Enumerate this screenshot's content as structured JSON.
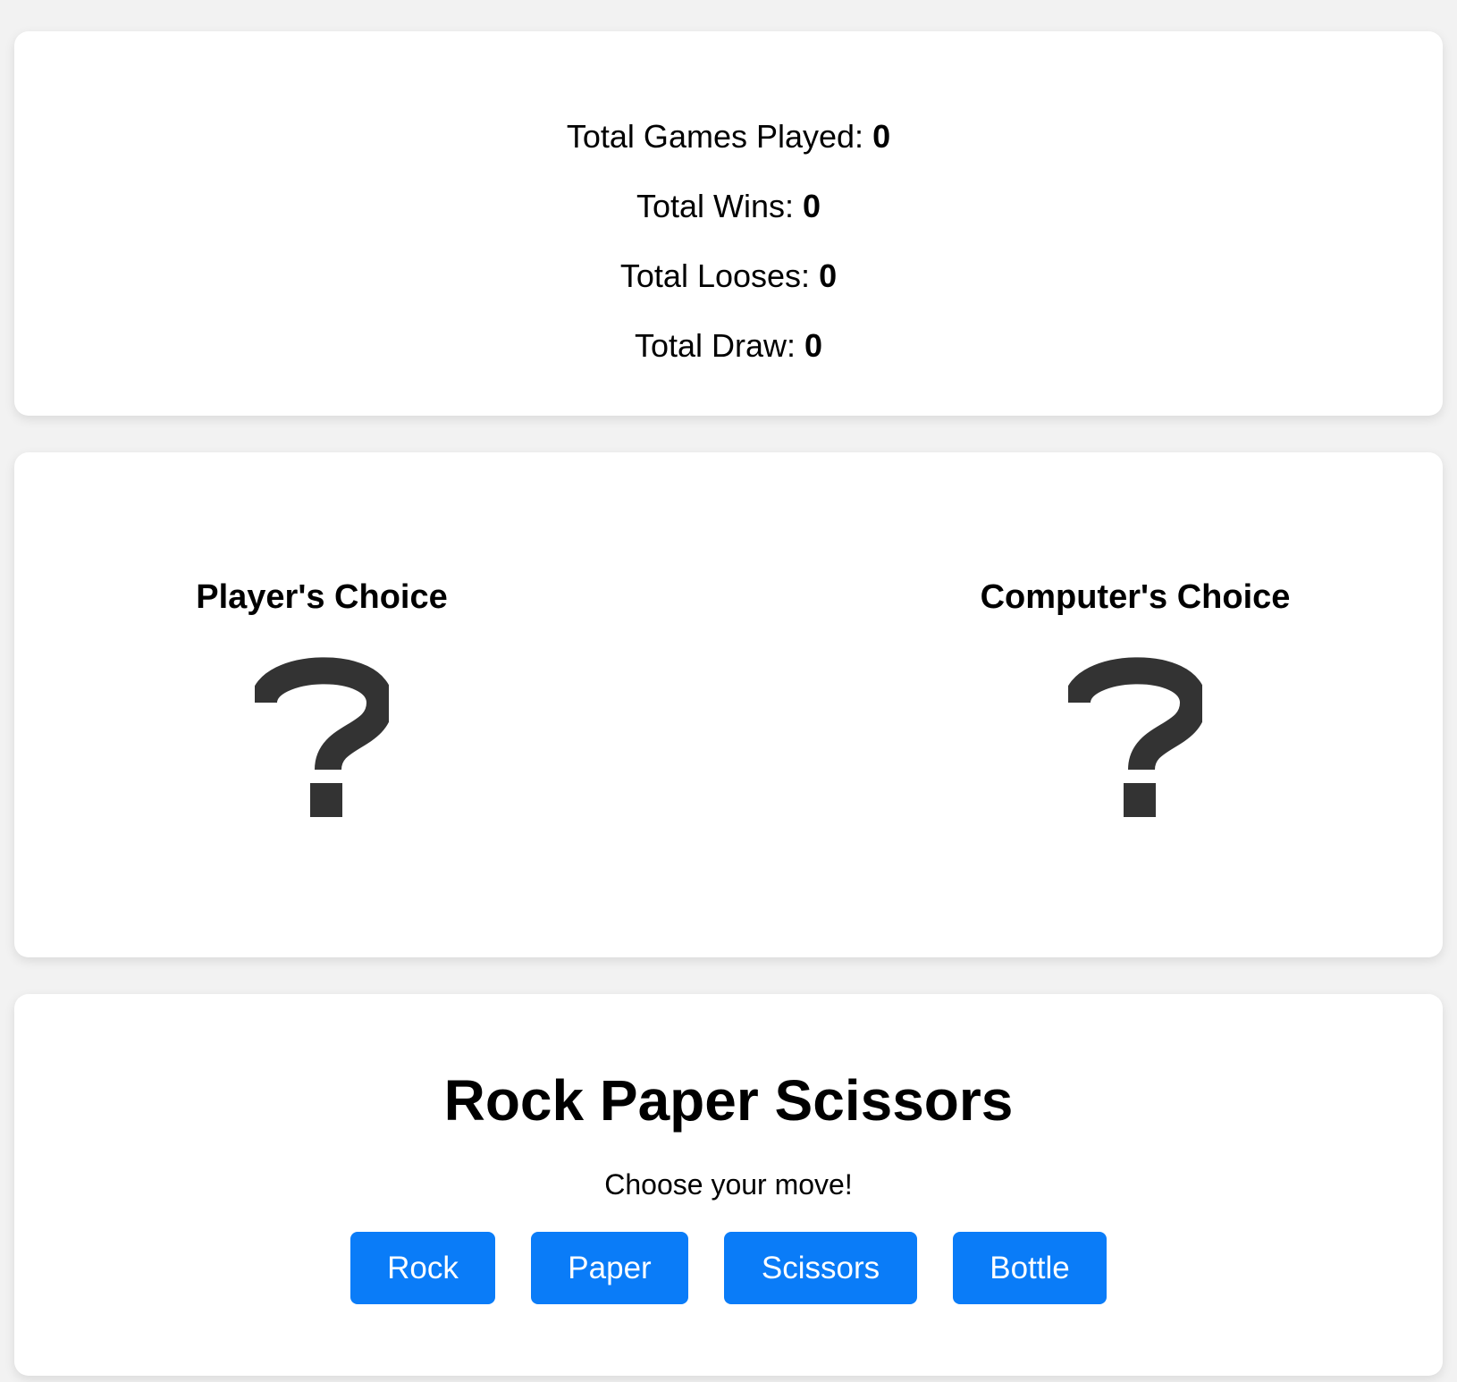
{
  "stats": {
    "games_played_label": "Total Games Played:",
    "games_played_value": "0",
    "wins_label": "Total Wins:",
    "wins_value": "0",
    "losses_label": "Total Looses:",
    "losses_value": "0",
    "draws_label": "Total Draw:",
    "draws_value": "0"
  },
  "choices": {
    "player_heading": "Player's Choice",
    "player_icon": "question-mark-icon",
    "computer_heading": "Computer's Choice",
    "computer_icon": "question-mark-icon"
  },
  "game": {
    "title": "Rock Paper Scissors",
    "subtitle": "Choose your move!",
    "buttons": [
      "Rock",
      "Paper",
      "Scissors",
      "Bottle"
    ]
  },
  "colors": {
    "page_background": "#f2f2f2",
    "card_background": "#ffffff",
    "button_background": "#0a7cf8",
    "button_text": "#ffffff",
    "icon": "#333333"
  }
}
